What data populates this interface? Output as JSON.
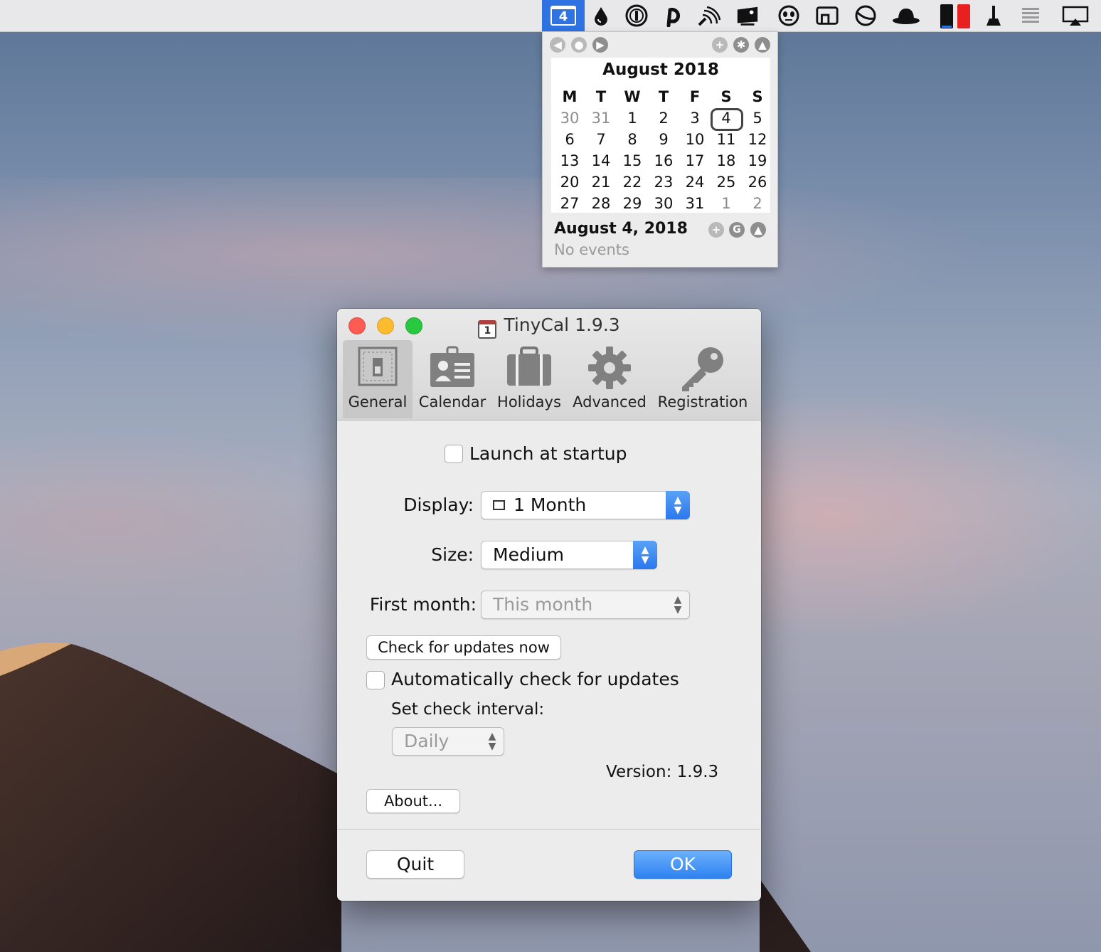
{
  "menubar": {
    "calendar_day": "4",
    "icons": [
      "drop-icon",
      "onepassword-icon",
      "pasta-icon",
      "feed-icon",
      "display-icon",
      "alien-icon",
      "screen-icon",
      "unit-icon",
      "hat-icon",
      "battery-icon",
      "cleaner-icon",
      "list-icon",
      "airplay-icon"
    ]
  },
  "popup": {
    "month_title": "August 2018",
    "weekday_headers": [
      "M",
      "T",
      "W",
      "T",
      "F",
      "S",
      "S"
    ],
    "weeks": [
      [
        "30",
        "31",
        "1",
        "2",
        "3",
        "4",
        "5"
      ],
      [
        "6",
        "7",
        "8",
        "9",
        "10",
        "11",
        "12"
      ],
      [
        "13",
        "14",
        "15",
        "16",
        "17",
        "18",
        "19"
      ],
      [
        "20",
        "21",
        "22",
        "23",
        "24",
        "25",
        "26"
      ],
      [
        "27",
        "28",
        "29",
        "30",
        "31",
        "1",
        "2"
      ]
    ],
    "selected_date": "August 4, 2018",
    "events_text": "No events",
    "footer_google": "G"
  },
  "window": {
    "title": "TinyCal 1.9.3",
    "app_icon_digit": "1",
    "tabs": [
      "General",
      "Calendar",
      "Holidays",
      "Advanced",
      "Registration"
    ],
    "active_tab": "General",
    "launch_at_startup": "Launch at startup",
    "display_label": "Display:",
    "display_value": "1 Month",
    "size_label": "Size:",
    "size_value": "Medium",
    "first_month_label": "First month:",
    "first_month_value": "This month",
    "check_updates_button": "Check for updates now",
    "auto_check_label": "Automatically check for updates",
    "interval_label": "Set check interval:",
    "interval_value": "Daily",
    "version_text": "Version: 1.9.3",
    "about_button": "About...",
    "quit_button": "Quit",
    "ok_button": "OK"
  },
  "colors": {
    "accent": "#2f73e2",
    "close": "#fd5b54",
    "minimize": "#fdbb2f",
    "zoom": "#28c840"
  }
}
